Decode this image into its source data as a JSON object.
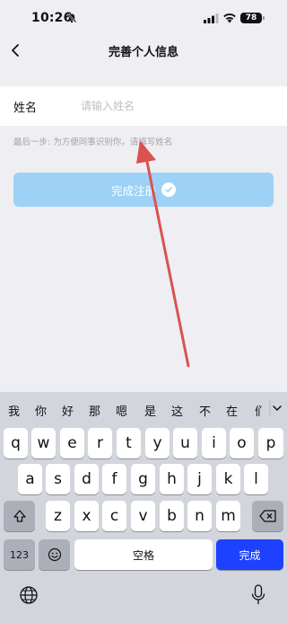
{
  "status_bar": {
    "time": "10:26",
    "battery": "78"
  },
  "nav": {
    "title": "完善个人信息"
  },
  "form": {
    "name_label": "姓名",
    "name_placeholder": "请输入姓名",
    "hint": "最后一步: 为方便同事识别你，请填写姓名",
    "submit_label": "完成注册"
  },
  "keyboard": {
    "candidates": [
      "我",
      "你",
      "好",
      "那",
      "嗯",
      "是",
      "这",
      "不",
      "在",
      "们"
    ],
    "row1": [
      "q",
      "w",
      "e",
      "r",
      "t",
      "y",
      "u",
      "i",
      "o",
      "p"
    ],
    "row2": [
      "a",
      "s",
      "d",
      "f",
      "g",
      "h",
      "j",
      "k",
      "l"
    ],
    "row3": [
      "z",
      "x",
      "c",
      "v",
      "b",
      "n",
      "m"
    ],
    "numbers_label": "123",
    "space_label": "空格",
    "done_label": "完成"
  },
  "colors": {
    "accent": "#9ed1f6",
    "done_key": "#1e40ff",
    "annotation": "#d9534f"
  }
}
